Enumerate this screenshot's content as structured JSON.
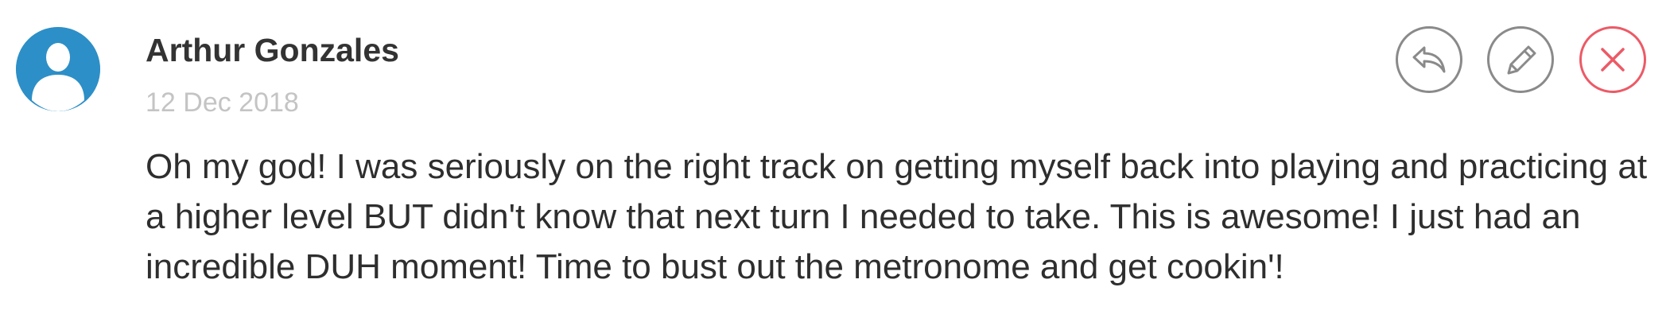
{
  "comment": {
    "author": "Arthur Gonzales",
    "date": "12 Dec 2018",
    "text": "Oh my god! I was seriously on the right track on getting myself back into playing and practicing at a higher level BUT didn't know that next turn I needed to take. This is awesome! I just had an incredible DUH moment! Time to bust out the metronome and get cookin'!"
  },
  "actions": {
    "reply_icon": "reply-arrow-icon",
    "edit_icon": "pencil-icon",
    "delete_icon": "close-icon"
  },
  "colors": {
    "avatar_bg": "#2d8fc7",
    "author_text": "#333333",
    "date_text": "#c4c4c4",
    "body_text": "#2e2e2e",
    "button_border": "#8a8a8a",
    "delete_accent": "#ec5a66"
  }
}
